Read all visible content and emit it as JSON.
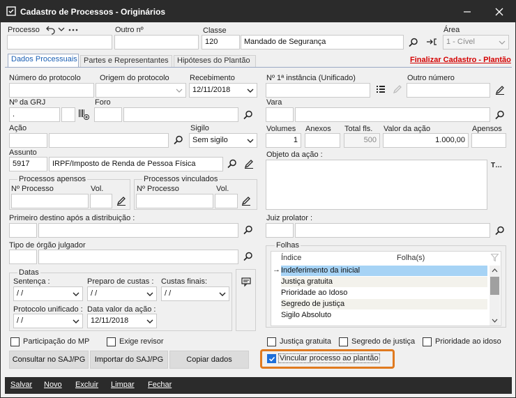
{
  "window": {
    "title": "Cadastro de Processos - Originários",
    "accent": "#2b2b2b"
  },
  "top": {
    "processo_label": "Processo",
    "outro_no_label": "Outro nº",
    "classe_label": "Classe",
    "classe_code": "120",
    "classe_name": "Mandado de Segurança",
    "area_label": "Área",
    "area_value": "1 - Cível"
  },
  "tabs": [
    {
      "label": "Dados Processuais"
    },
    {
      "label": "Partes e Representantes"
    },
    {
      "label": "Hipóteses do Plantão"
    }
  ],
  "finalizar_link": "Finalizar Cadastro - Plantão",
  "left": {
    "num_protocolo_label": "Número do protocolo",
    "origem_label": "Origem do protocolo",
    "recebimento_label": "Recebimento",
    "recebimento_value": "12/11/2018",
    "grj_label": "Nº da GRJ",
    "grj_value": ".",
    "foro_label": "Foro",
    "acao_label": "Ação",
    "sigilo_label": "Sigilo",
    "sigilo_value": "Sem sigilo",
    "assunto_label": "Assunto",
    "assunto_code": "5917",
    "assunto_name": "IRPF/Imposto de Renda de Pessoa Física",
    "apensos_title": "Processos apensos",
    "vinculados_title": "Processos vinculados",
    "no_processo_label": "Nº Processo",
    "vol_label": "Vol.",
    "primeiro_destino_label": "Primeiro destino após a distribuição :",
    "tipo_orgao_label": "Tipo de órgão julgador",
    "datas_title": "Datas",
    "sentenca_label": "Sentença :",
    "preparo_label": "Preparo de custas :",
    "custas_finais_label": "Custas finais:",
    "date_empty": "/  /",
    "protocolo_unificado_label": "Protocolo unificado :",
    "data_valor_label": "Data valor da ação :",
    "data_valor_value": "12/11/2018",
    "participacao_mp": "Participação do MP",
    "exige_revisor": "Exige revisor"
  },
  "right": {
    "instancia_label": "Nº 1ª instância (Unificado)",
    "outro_numero_label": "Outro número",
    "vara_label": "Vara",
    "volumes_label": "Volumes",
    "volumes_value": "1",
    "anexos_label": "Anexos",
    "total_fls_label": "Total fls.",
    "total_fls_value": "500",
    "valor_acao_label": "Valor da ação",
    "valor_acao_value": "1.000,00",
    "apensos_label": "Apensos",
    "objeto_label": "Objeto da ação :",
    "juiz_label": "Juiz prolator :",
    "folhas_title": "Folhas",
    "col_indice": "Índice",
    "col_folhas": "Folha(s)",
    "folhas_items": [
      {
        "label": "Indeferimento da inicial"
      },
      {
        "label": "Justiça gratuita"
      },
      {
        "label": "Prioridade ao Idoso"
      },
      {
        "label": "Segredo de justiça"
      },
      {
        "label": "Sigilo Absoluto"
      }
    ],
    "chk_justica": "Justiça gratuita",
    "chk_segredo": "Segredo de justiça",
    "chk_prioridade": "Prioridade ao idoso",
    "chk_vincular": "Vincular processo ao plantão",
    "highlight_color": "#e07a1f",
    "selection_color": "#a6d3f5"
  },
  "buttons": {
    "consultar": "Consultar no SAJ/PG",
    "importar": "Importar do SAJ/PG",
    "copiar": "Copiar dados"
  },
  "bottombar": {
    "salvar": "Salvar",
    "novo": "Novo",
    "excluir": "Excluir",
    "limpar": "Limpar",
    "fechar": "Fechar"
  }
}
